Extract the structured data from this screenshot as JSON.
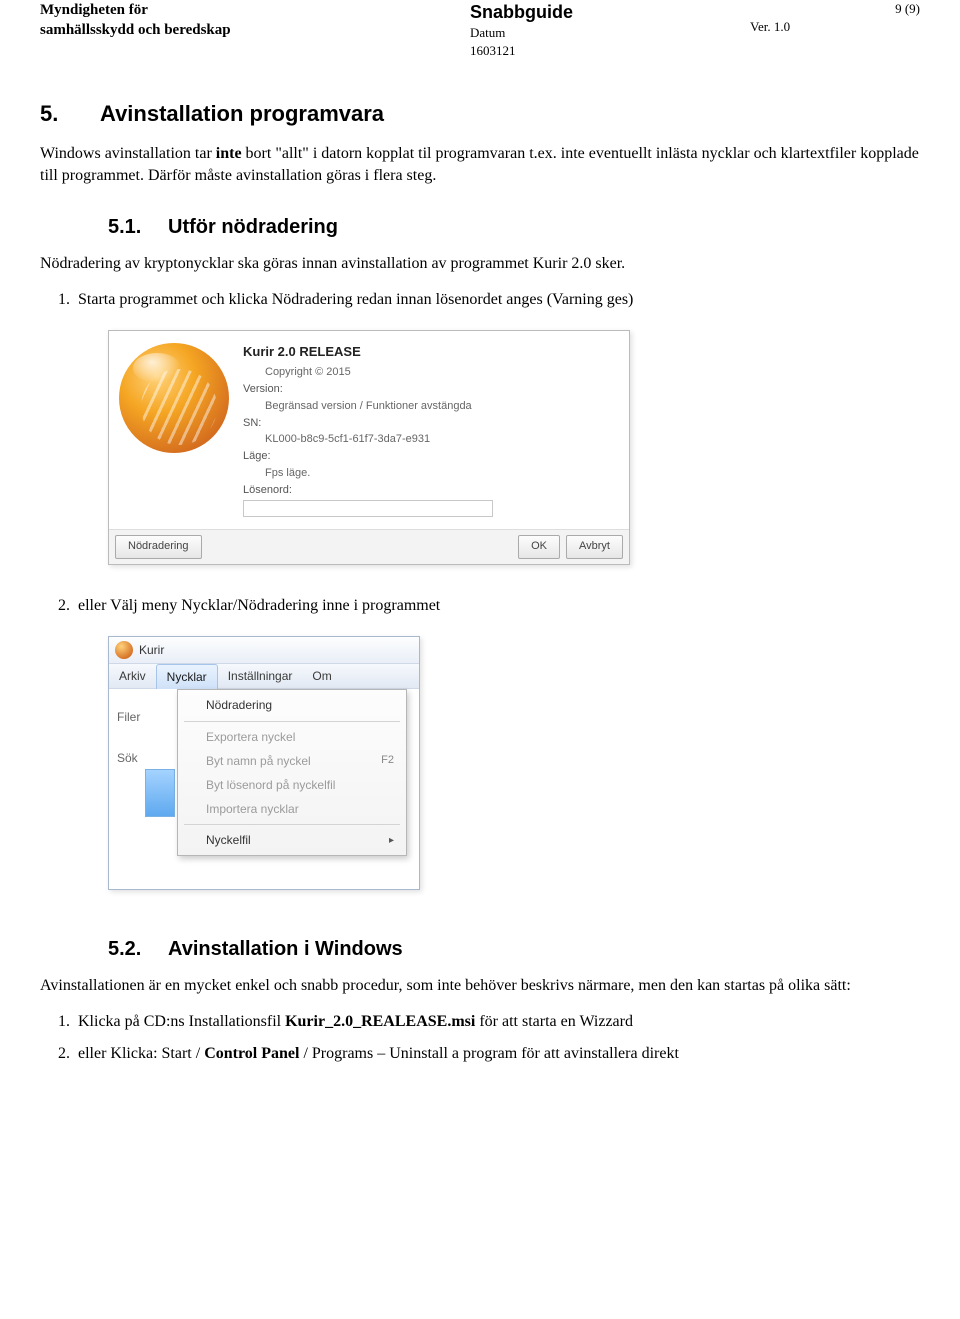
{
  "header": {
    "org_line1": "Myndigheten för",
    "org_line2": "samhällsskydd och beredskap",
    "mid_title": "Snabbguide",
    "mid_sub1": "Datum",
    "mid_sub2": "1603121",
    "right_line": "Ver. 1.0",
    "page": "9 (9)"
  },
  "s5": {
    "num": "5.",
    "title": "Avinstallation programvara",
    "p1a": "Windows avinstallation tar ",
    "p1b": "inte",
    "p1c": " bort \"allt\" i datorn kopplat til programvaran t.ex. inte eventuellt inlästa nycklar och klartextfiler kopplade till programmet. Därför måste avinstallation göras i flera steg."
  },
  "s51": {
    "num": "5.1.",
    "title": "Utför nödradering",
    "p1": "Nödradering av kryptonycklar ska göras innan avinstallation av programmet Kurir 2.0 sker.",
    "li1": "Starta programmet och klicka Nödradering redan innan lösenordet anges (Varning ges)",
    "li2": "eller Välj meny Nycklar/Nödradering inne i programmet"
  },
  "dialog": {
    "title": "Kurir 2.0 RELEASE",
    "copyright": "Copyright © 2015",
    "version_label": "Version:",
    "version_value": "Begränsad version / Funktioner avstängda",
    "sn_label": "SN:",
    "sn_value": "KL000-b8c9-5cf1-61f7-3da7-e931",
    "lage_label": "Läge:",
    "lage_value": "Fps läge.",
    "losen_label": "Lösenord:",
    "btn_left": "Nödradering",
    "btn_ok": "OK",
    "btn_cancel": "Avbryt"
  },
  "appwin": {
    "title": "Kurir",
    "menu": {
      "arkiv": "Arkiv",
      "nycklar": "Nycklar",
      "inst": "Inställningar",
      "om": "Om"
    },
    "side": {
      "filer": "Filer",
      "sok": "Sök"
    },
    "dd": {
      "nodradering": "Nödradering",
      "exportera": "Exportera nyckel",
      "bytnamn": "Byt namn på nyckel",
      "bytnamn_sc": "F2",
      "bytlosen": "Byt lösenord på nyckelfil",
      "importera": "Importera nycklar",
      "nyckelfil": "Nyckelfil"
    }
  },
  "s52": {
    "num": "5.2.",
    "title": "Avinstallation i Windows",
    "p1": "Avinstallationen är en mycket enkel och snabb procedur, som inte behöver beskrivs närmare, men den kan startas på olika sätt:",
    "li1a": "Klicka på CD:ns Installationsfil ",
    "li1b": "Kurir_2.0_REALEASE.msi",
    "li1c": " för att starta en Wizzard",
    "li2a": "eller Klicka: Start / ",
    "li2b": "Control Panel",
    "li2c": " / Programs – Uninstall a program för att avinstallera direkt"
  }
}
